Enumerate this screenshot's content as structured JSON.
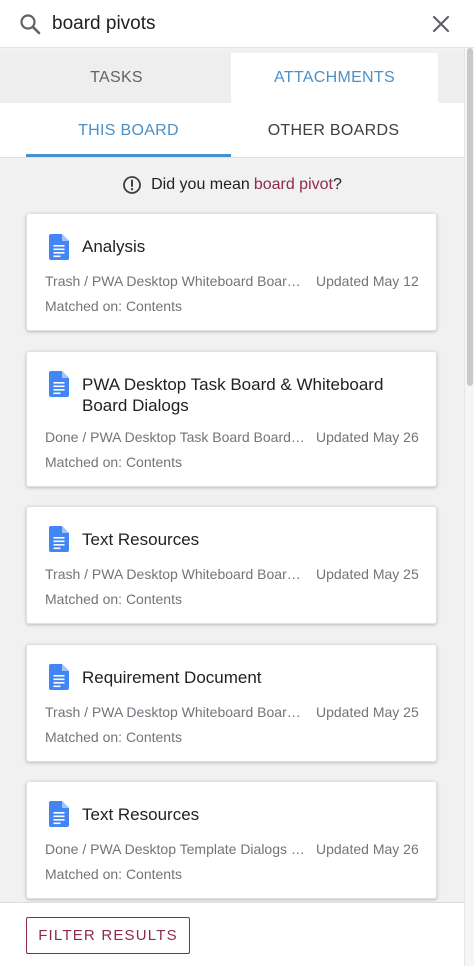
{
  "search": {
    "value": "board pivots",
    "search_icon": "search-icon",
    "close_icon": "close-icon"
  },
  "main_tabs": [
    {
      "label": "TASKS",
      "active": false
    },
    {
      "label": "ATTACHMENTS",
      "active": true
    }
  ],
  "sub_tabs": [
    {
      "label": "THIS BOARD",
      "active": true
    },
    {
      "label": "OTHER BOARDS",
      "active": false
    }
  ],
  "suggestion": {
    "prefix": "Did you mean",
    "term": "board pivot",
    "suffix": "?",
    "icon": "info-icon"
  },
  "results": [
    {
      "title": "Analysis",
      "path": "Trash / PWA Desktop Whiteboard Board Dialogs",
      "updated": "Updated May 12",
      "matched": "Matched on: Contents",
      "icon": "google-doc-icon"
    },
    {
      "title": "PWA Desktop Task Board & Whiteboard Board Dialogs",
      "path": "Done / PWA Desktop Task Board Board Dialogs",
      "updated": "Updated May 26",
      "matched": "Matched on: Contents",
      "icon": "google-doc-icon"
    },
    {
      "title": "Text Resources",
      "path": "Trash / PWA Desktop Whiteboard Board Dialogs",
      "updated": "Updated May 25",
      "matched": "Matched on: Contents",
      "icon": "google-doc-icon"
    },
    {
      "title": "Requirement Document",
      "path": "Trash / PWA Desktop Whiteboard Board Dialogs",
      "updated": "Updated May 25",
      "matched": "Matched on: Contents",
      "icon": "google-doc-icon"
    },
    {
      "title": "Text Resources",
      "path": "Done / PWA Desktop Template Dialogs [Template]",
      "updated": "Updated May 26",
      "matched": "Matched on: Contents",
      "icon": "google-doc-icon"
    }
  ],
  "footer": {
    "filter_label": "FILTER RESULTS"
  },
  "colors": {
    "accent_blue": "#4a90c8",
    "accent_maroon": "#8e2a4e",
    "doc_blue": "#4285f4"
  }
}
